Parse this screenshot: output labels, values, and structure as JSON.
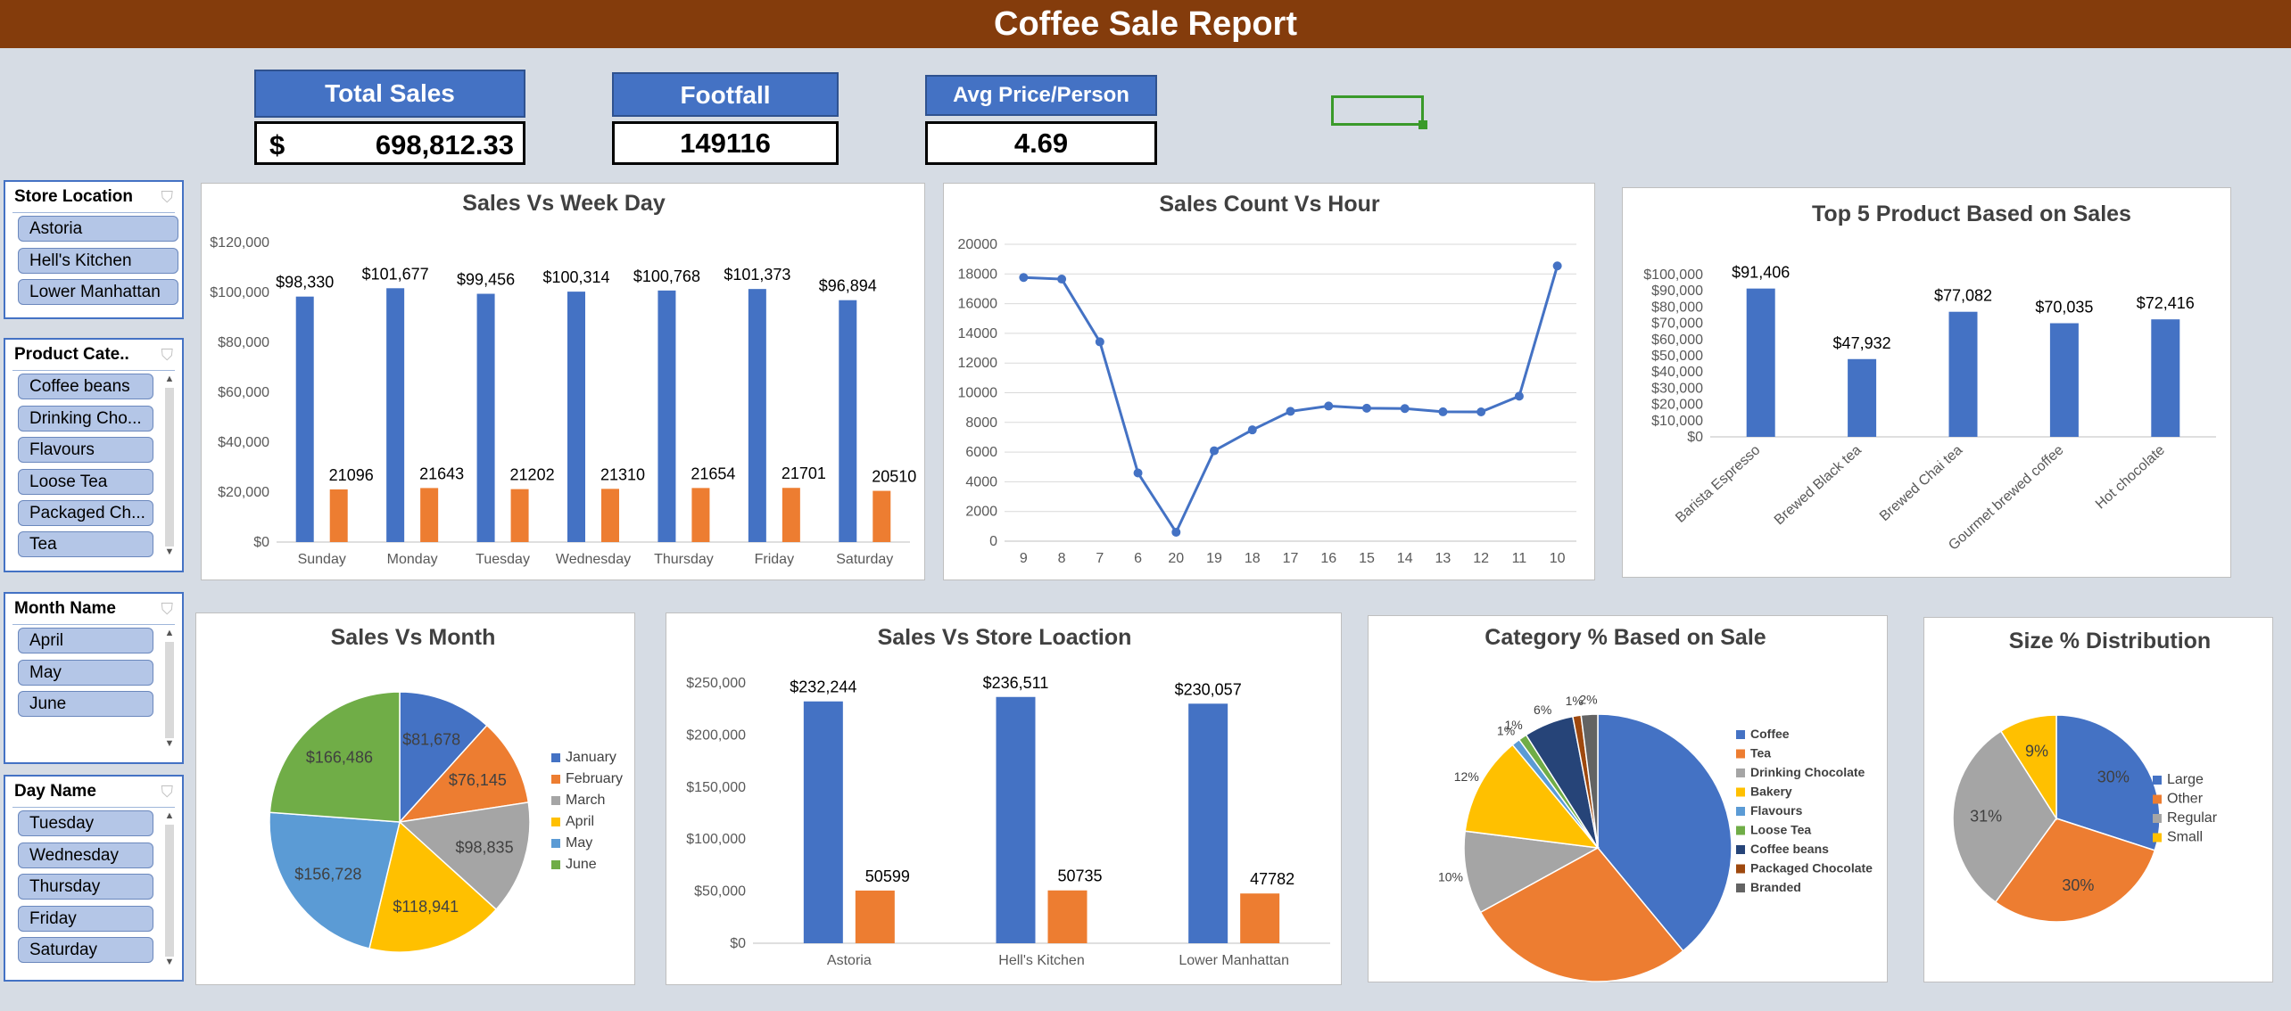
{
  "report_title": "Coffee Sale Report",
  "kpis": {
    "total_sales_label": "Total Sales",
    "total_sales_currency": "$",
    "total_sales_value": "698,812.33",
    "footfall_label": "Footfall",
    "footfall_value": "149116",
    "avg_price_label": "Avg Price/Person",
    "avg_price_value": "4.69"
  },
  "slicers": {
    "store_location": {
      "title": "Store Location",
      "items": [
        "Astoria",
        "Hell's Kitchen",
        "Lower Manhattan"
      ]
    },
    "product_category": {
      "title": "Product Cate..",
      "items": [
        "Coffee beans",
        "Drinking Cho...",
        "Flavours",
        "Loose Tea",
        "Packaged Ch...",
        "Tea"
      ]
    },
    "month_name": {
      "title": "Month Name",
      "items": [
        "April",
        "May",
        "June"
      ]
    },
    "day_name": {
      "title": "Day Name",
      "items": [
        "Tuesday",
        "Wednesday",
        "Thursday",
        "Friday",
        "Saturday"
      ]
    }
  },
  "colors": {
    "banner": "#843c0c",
    "blue": "#4472c4",
    "orange": "#ed7d31",
    "gray": "#a5a5a5",
    "gold": "#ffc000",
    "lightblue": "#5b9bd5",
    "green": "#70ad47",
    "navy": "#264478",
    "brown": "#9e480e",
    "darkgray": "#636363"
  },
  "icons": {
    "filter_icon": "clear-filter-icon"
  },
  "chart_data": [
    {
      "id": "weekday",
      "type": "bar",
      "title": "Sales Vs Week Day",
      "categories": [
        "Sunday",
        "Monday",
        "Tuesday",
        "Wednesday",
        "Thursday",
        "Friday",
        "Saturday"
      ],
      "series": [
        {
          "values": [
            98330,
            101677,
            99456,
            100314,
            100768,
            101373,
            96894
          ],
          "labels": [
            "$98,330",
            "$101,677",
            "$99,456",
            "$100,314",
            "$100,768",
            "$101,373",
            "$96,894"
          ]
        },
        {
          "values": [
            21096,
            21643,
            21202,
            21310,
            21654,
            21701,
            20510
          ],
          "labels": [
            "21096",
            "21643",
            "21202",
            "21310",
            "21654",
            "21701",
            "20510"
          ]
        }
      ],
      "ylim": [
        0,
        120000
      ],
      "yticks": [
        "$0",
        "$20,000",
        "$40,000",
        "$60,000",
        "$80,000",
        "$100,000",
        "$120,000"
      ]
    },
    {
      "id": "hour",
      "type": "line",
      "title": "Sales Count Vs Hour",
      "categories": [
        "9",
        "8",
        "7",
        "6",
        "20",
        "19",
        "18",
        "17",
        "16",
        "15",
        "14",
        "13",
        "12",
        "11",
        "10"
      ],
      "values": [
        17764,
        17654,
        13428,
        4594,
        603,
        6092,
        7498,
        8745,
        9103,
        8958,
        8933,
        8714,
        8708,
        9766,
        18545
      ],
      "ylim": [
        0,
        20000
      ],
      "yticks": [
        "0",
        "2000",
        "4000",
        "6000",
        "8000",
        "10000",
        "12000",
        "14000",
        "16000",
        "18000",
        "20000"
      ]
    },
    {
      "id": "top5",
      "type": "bar",
      "title": "Top 5 Product Based on Sales",
      "categories": [
        "Barista Espresso",
        "Brewed Black tea",
        "Brewed Chai tea",
        "Gourmet brewed coffee",
        "Hot chocolate"
      ],
      "values": [
        91406,
        47932,
        77082,
        70035,
        72416
      ],
      "labels": [
        "$91,406",
        "$47,932",
        "$77,082",
        "$70,035",
        "$72,416"
      ],
      "ylim": [
        0,
        100000
      ],
      "yticks": [
        "$0",
        "$10,000",
        "$20,000",
        "$30,000",
        "$40,000",
        "$50,000",
        "$60,000",
        "$70,000",
        "$80,000",
        "$90,000",
        "$100,000"
      ]
    },
    {
      "id": "month",
      "type": "pie",
      "title": "Sales Vs Month",
      "categories": [
        "January",
        "February",
        "March",
        "April",
        "May",
        "June"
      ],
      "values": [
        81678,
        76145,
        98835,
        118941,
        156728,
        166486
      ],
      "labels": [
        "$81,678",
        "$76,145",
        "$98,835",
        "$118,941",
        "$156,728",
        "$166,486"
      ]
    },
    {
      "id": "store",
      "type": "bar",
      "title": "Sales Vs Store Loaction",
      "categories": [
        "Astoria",
        "Hell's Kitchen",
        "Lower Manhattan"
      ],
      "series": [
        {
          "values": [
            232244,
            236511,
            230057
          ],
          "labels": [
            "$232,244",
            "$236,511",
            "$230,057"
          ]
        },
        {
          "values": [
            50599,
            50735,
            47782
          ],
          "labels": [
            "50599",
            "50735",
            "47782"
          ]
        }
      ],
      "ylim": [
        0,
        250000
      ],
      "yticks": [
        "$0",
        "$50,000",
        "$100,000",
        "$150,000",
        "$200,000",
        "$250,000"
      ]
    },
    {
      "id": "category",
      "type": "pie",
      "title": "Category % Based on Sale",
      "categories": [
        "Coffee",
        "Tea",
        "Drinking Chocolate",
        "Bakery",
        "Flavours",
        "Loose Tea",
        "Coffee beans",
        "Packaged Chocolate",
        "Branded"
      ],
      "values": [
        39,
        28,
        10,
        12,
        1,
        1,
        6,
        1,
        2
      ],
      "labels": [
        "",
        "28%",
        "10%",
        "12%",
        "1%",
        "1%",
        "6%",
        "1%",
        "2%"
      ]
    },
    {
      "id": "size",
      "type": "pie",
      "title": "Size % Distribution",
      "categories": [
        "Large",
        "Other",
        "Regular",
        "Small"
      ],
      "values": [
        30,
        30,
        31,
        9
      ],
      "labels": [
        "30%",
        "30%",
        "31%",
        "9%"
      ]
    }
  ]
}
